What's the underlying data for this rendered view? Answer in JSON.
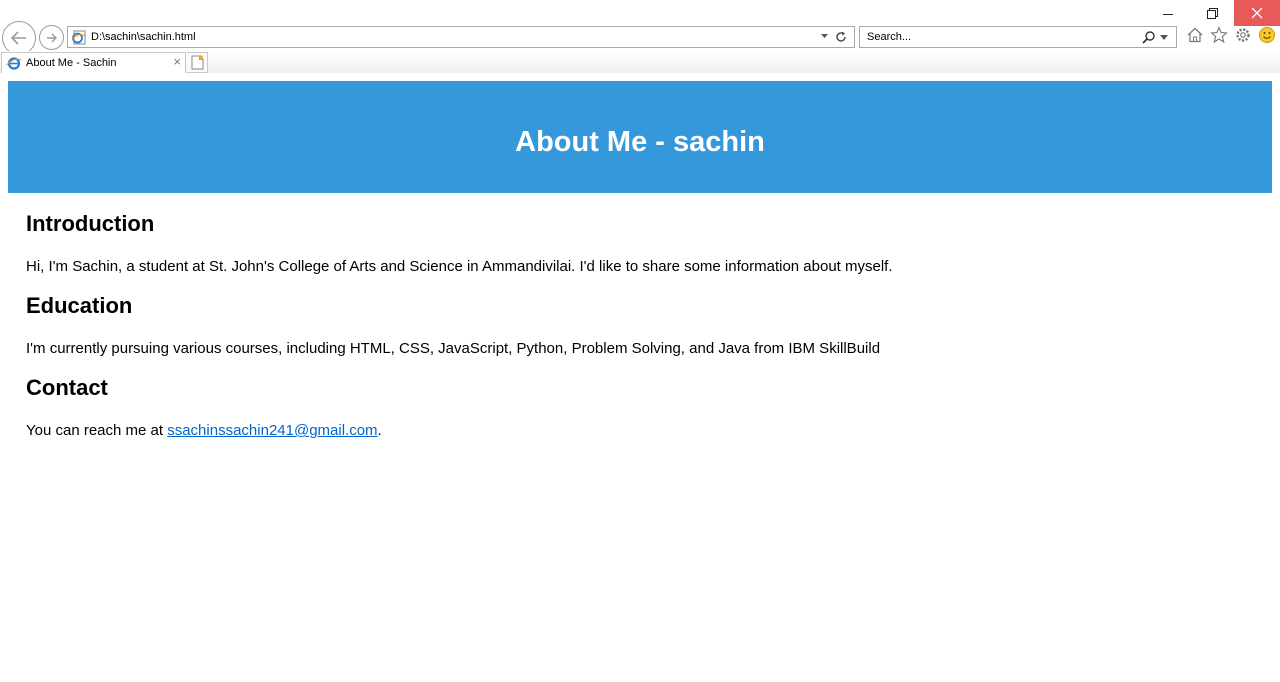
{
  "browser": {
    "address": "D:\\sachin\\sachin.html",
    "search_placeholder": "Search...",
    "tab_title": "About Me - Sachin",
    "tab_close": "×"
  },
  "page": {
    "header_title": "About Me - sachin",
    "sections": [
      {
        "heading": "Introduction",
        "text": "Hi, I'm Sachin, a student at St. John's College of Arts and Science in Ammandivilai. I'd like to share some information about myself."
      },
      {
        "heading": "Education",
        "text": "I'm currently pursuing various courses, including HTML, CSS, JavaScript, Python, Problem Solving, and Java from IBM SkillBuild"
      },
      {
        "heading": "Contact",
        "text_prefix": "You can reach me at ",
        "email": "ssachinssachin241@gmail.com",
        "text_suffix": "."
      }
    ],
    "colors": {
      "header_bg": "#3498db",
      "link": "#0066cc"
    }
  }
}
